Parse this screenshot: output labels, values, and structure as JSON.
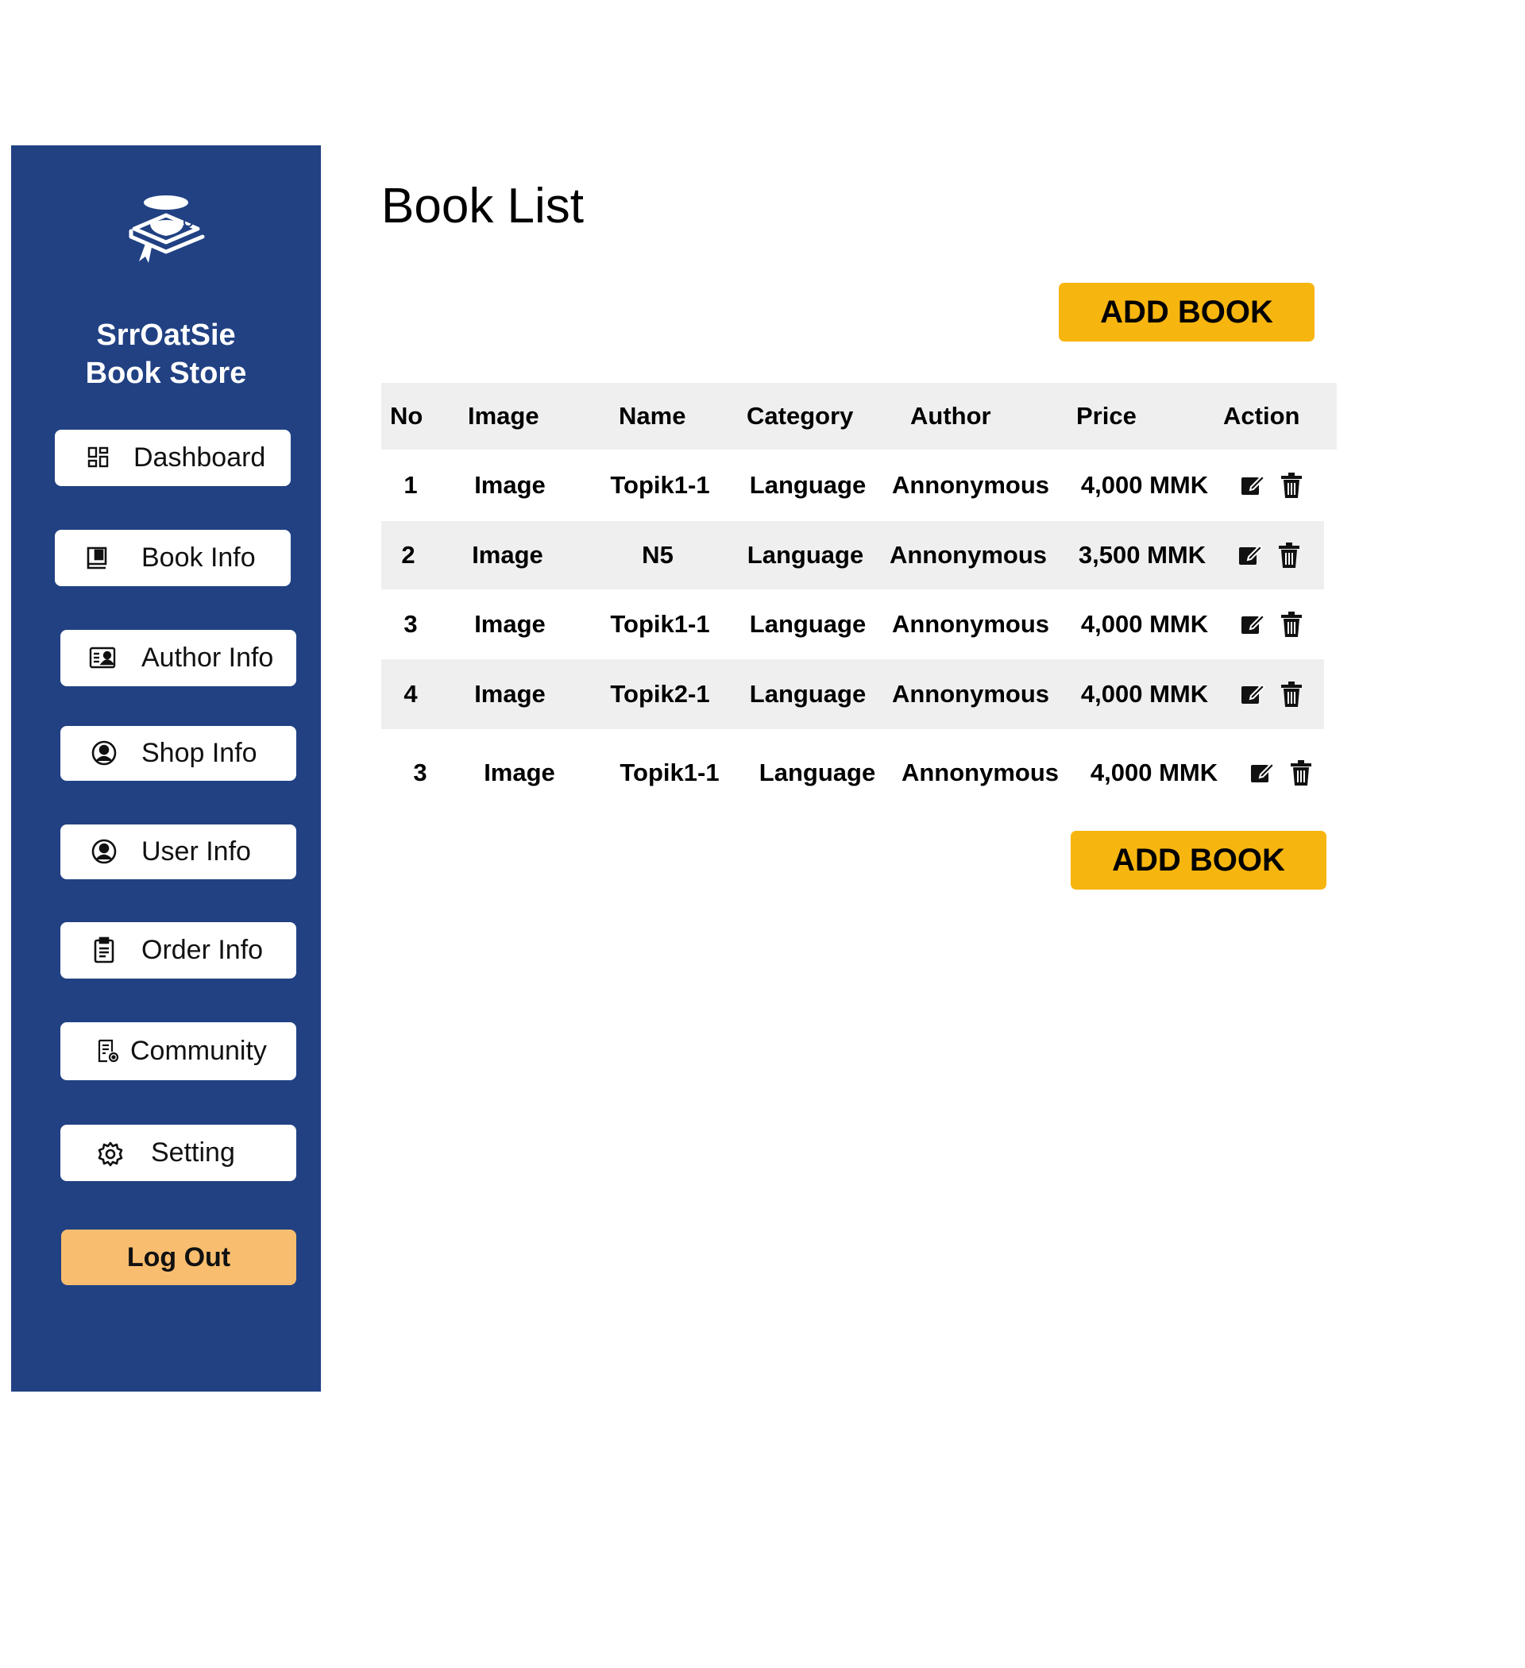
{
  "sidebar": {
    "brand_line1": "SrrOatSie",
    "brand_line2": "Book Store",
    "logo_icon": "book-stack-icon",
    "items": [
      {
        "label": "Dashboard",
        "icon": "dashboard-grid-icon"
      },
      {
        "label": "Book Info",
        "icon": "book-icon"
      },
      {
        "label": "Author Info",
        "icon": "id-card-icon"
      },
      {
        "label": "Shop Info",
        "icon": "user-circle-icon"
      },
      {
        "label": "User Info",
        "icon": "user-circle-icon"
      },
      {
        "label": "Order Info",
        "icon": "clipboard-icon"
      },
      {
        "label": "Community",
        "icon": "document-gear-icon"
      },
      {
        "label": "Setting",
        "icon": "gear-icon"
      }
    ],
    "logout_label": "Log Out"
  },
  "main": {
    "title": "Book List",
    "add_book_label": "ADD BOOK",
    "table": {
      "headers": [
        "No",
        "Image",
        "Name",
        "Category",
        "Author",
        "Price",
        "Action"
      ],
      "rows": [
        {
          "no": "1",
          "image": "Image",
          "name": "Topik1-1",
          "category": "Language",
          "author": "Annonymous",
          "price": "4,000 MMK"
        },
        {
          "no": "2",
          "image": "Image",
          "name": "N5",
          "category": "Language",
          "author": "Annonymous",
          "price": "3,500 MMK"
        },
        {
          "no": "3",
          "image": "Image",
          "name": "Topik1-1",
          "category": "Language",
          "author": "Annonymous",
          "price": "4,000 MMK"
        },
        {
          "no": "4",
          "image": "Image",
          "name": "Topik2-1",
          "category": "Language",
          "author": "Annonymous",
          "price": "4,000 MMK"
        },
        {
          "no": "3",
          "image": "Image",
          "name": "Topik1-1",
          "category": "Language",
          "author": "Annonymous",
          "price": "4,000 MMK"
        }
      ],
      "action_icons": [
        "edit-icon",
        "trash-icon"
      ]
    }
  },
  "colors": {
    "sidebar_bg": "#214183",
    "add_book_bg": "#f7b50f",
    "logout_bg": "#f8bd6e",
    "row_shade": "#efefef"
  }
}
